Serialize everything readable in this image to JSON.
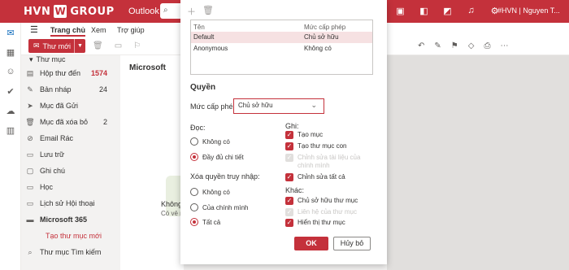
{
  "topbar": {
    "brand": "HVN",
    "brand_suffix": "GROUP",
    "app_name": "Outlook",
    "user": "#HVN | Nguyen T...",
    "icons": [
      "meet-icon",
      "teams-icon",
      "word-icon",
      "bell-icon",
      "gear-icon",
      "lightbulb-icon"
    ]
  },
  "ribbon": {
    "tabs": [
      "Trang chủ",
      "Xem",
      "Trợ giúp"
    ],
    "new_mail": "Thư mới"
  },
  "folders": {
    "header": "Thư mục",
    "items": [
      {
        "label": "Hộp thư đến",
        "count": "1574",
        "icon": "inbox-icon"
      },
      {
        "label": "Bản nháp",
        "count": "24",
        "icon": "draft-icon"
      },
      {
        "label": "Mục đã Gửi",
        "count": "",
        "icon": "sent-icon"
      },
      {
        "label": "Mục đã xóa bỏ",
        "count": "2",
        "icon": "trash-icon"
      },
      {
        "label": "Email Rác",
        "count": "",
        "icon": "junk-icon"
      },
      {
        "label": "Lưu trữ",
        "count": "",
        "icon": "archive-icon"
      },
      {
        "label": "Ghi chú",
        "count": "",
        "icon": "note-icon"
      },
      {
        "label": "Học",
        "count": "",
        "icon": "folder-icon"
      },
      {
        "label": "Lịch sử Hội thoại",
        "count": "",
        "icon": "folder-icon"
      },
      {
        "label": "Microsoft 365",
        "count": "",
        "icon": "folder-icon"
      },
      {
        "label": "Tạo thư mục mới",
        "count": "",
        "icon": ""
      },
      {
        "label": "Thư mục Tìm kiếm",
        "count": "",
        "icon": "search-folder-icon"
      }
    ]
  },
  "message_list": {
    "header": "Microsoft",
    "empty_title": "Không",
    "empty_sub": "Có vẻ n"
  },
  "dialog": {
    "table": {
      "col_name": "Tên",
      "col_level": "Mức cấp phép",
      "rows": [
        {
          "name": "Default",
          "level": "Chủ sở hữu",
          "selected": true
        },
        {
          "name": "Anonymous",
          "level": "Không có",
          "selected": false
        }
      ]
    },
    "section_title": "Quyền",
    "level_label": "Mức cấp phép",
    "level_value": "Chủ sở hữu",
    "read": {
      "label": "Đọc:",
      "options": [
        {
          "label": "Không có",
          "checked": false
        },
        {
          "label": "Đầy đủ chi tiết",
          "checked": true
        }
      ]
    },
    "delete": {
      "label": "Xóa quyền truy nhập:",
      "options": [
        {
          "label": "Không có",
          "checked": false
        },
        {
          "label": "Của chính mình",
          "checked": false
        },
        {
          "label": "Tất cả",
          "checked": true
        }
      ]
    },
    "write": {
      "label": "Ghi:",
      "options": [
        {
          "label": "Tạo mục",
          "checked": true,
          "disabled": false
        },
        {
          "label": "Tạo thư mục con",
          "checked": true,
          "disabled": false
        },
        {
          "label": "Chỉnh sửa tài liệu của chính mình",
          "checked": true,
          "disabled": true
        },
        {
          "label": "Chỉnh sửa tất cả",
          "checked": true,
          "disabled": false
        }
      ]
    },
    "other": {
      "label": "Khác:",
      "options": [
        {
          "label": "Chủ sở hữu thư mục",
          "checked": true,
          "disabled": false
        },
        {
          "label": "Liên hệ của thư mục",
          "checked": true,
          "disabled": true
        },
        {
          "label": "Hiển thị thư mục",
          "checked": true,
          "disabled": false
        }
      ]
    },
    "ok_label": "OK",
    "cancel_label": "Hủy bỏ"
  }
}
